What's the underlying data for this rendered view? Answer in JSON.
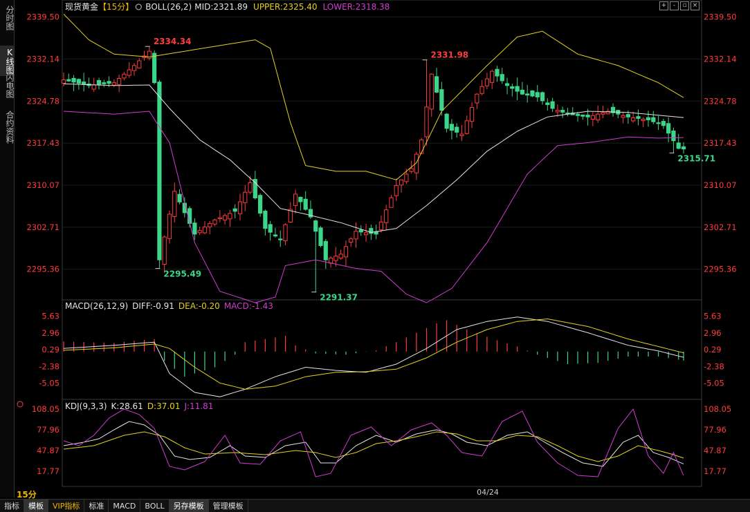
{
  "sidebar": {
    "items": [
      "分时图",
      "K线图",
      "闪电图",
      "合约资料"
    ],
    "active_index": 1
  },
  "header": {
    "symbol": "现货黄金",
    "period_tag": "【15分】",
    "indicator": "BOLL(26,2)",
    "mid_label": "MID:",
    "mid": "2321.89",
    "upper_label": "UPPER:",
    "upper": "2325.40",
    "lower_label": "LOWER:",
    "lower": "2318.38",
    "window_icons": [
      "expand-icon",
      "shrink-icon",
      "restore-icon",
      "close-icon"
    ]
  },
  "macd_header": {
    "name": "MACD(26,12,9)",
    "diff_label": "DIFF:",
    "diff": "-0.91",
    "dea_label": "DEA:",
    "dea": "-0.20",
    "macd_label": "MACD:",
    "macd": "-1.43"
  },
  "kdj_header": {
    "name": "KDJ(9,3,3)",
    "k_label": "K:",
    "k": "28.61",
    "d_label": "D:",
    "d": "37.01",
    "j_label": "J:",
    "j": "11.81"
  },
  "bottom": {
    "period": "15分",
    "date_label": "04/24",
    "tabs": [
      "指标",
      "模板",
      "VIP指标",
      "标准",
      "MACD",
      "BOLL",
      "另存模板",
      "管理模板"
    ],
    "active_tabs": [
      1,
      6
    ],
    "vip_tab": 2
  },
  "colors": {
    "up": "#ff3c3c",
    "down": "#3cd68a",
    "mid": "#e6e6e6",
    "upper": "#e6d21e",
    "lower": "#d23cd2",
    "axis_text": "#ff3c3c",
    "macd_dea": "#e6d21e",
    "kdj_j": "#d23cd2"
  },
  "chart_data": [
    {
      "type": "candlestick",
      "name_label": "现货黄金 15分",
      "y_ticks": [
        "2339.50",
        "2332.14",
        "2324.78",
        "2317.43",
        "2310.07",
        "2302.71",
        "2295.36"
      ],
      "ylim": [
        2290.0,
        2341.5
      ],
      "annotations": [
        {
          "text": "2334.34",
          "index": 17,
          "value": 2334.34,
          "kind": "high"
        },
        {
          "text": "2295.49",
          "index": 19,
          "value": 2295.49,
          "kind": "low"
        },
        {
          "text": "2291.37",
          "index": 50,
          "value": 2291.37,
          "kind": "low"
        },
        {
          "text": "2331.98",
          "index": 72,
          "value": 2331.98,
          "kind": "high"
        },
        {
          "text": "2315.71",
          "index": 121,
          "value": 2315.71,
          "kind": "low"
        }
      ],
      "ohlc_keypoints": [
        [
          0,
          2328.5
        ],
        [
          5,
          2327.5
        ],
        [
          10,
          2328.0
        ],
        [
          14,
          2331.0
        ],
        [
          17,
          2333.5
        ],
        [
          18,
          2328.0
        ],
        [
          19,
          2297.0
        ],
        [
          22,
          2309.0
        ],
        [
          26,
          2301.5
        ],
        [
          30,
          2304.0
        ],
        [
          34,
          2305.5
        ],
        [
          37,
          2310.5
        ],
        [
          40,
          2302.5
        ],
        [
          43,
          2300.5
        ],
        [
          46,
          2308.5
        ],
        [
          49,
          2304.5
        ],
        [
          52,
          2297.0
        ],
        [
          55,
          2298.0
        ],
        [
          58,
          2302.0
        ],
        [
          62,
          2301.5
        ],
        [
          66,
          2310.0
        ],
        [
          69,
          2313.0
        ],
        [
          71,
          2318.0
        ],
        [
          73,
          2329.5
        ],
        [
          76,
          2320.0
        ],
        [
          79,
          2319.0
        ],
        [
          82,
          2326.0
        ],
        [
          85,
          2330.0
        ],
        [
          88,
          2327.5
        ],
        [
          91,
          2326.0
        ],
        [
          94,
          2325.5
        ],
        [
          97,
          2323.5
        ],
        [
          100,
          2322.5
        ],
        [
          104,
          2322.0
        ],
        [
          108,
          2323.0
        ],
        [
          112,
          2322.0
        ],
        [
          116,
          2321.5
        ],
        [
          119,
          2320.5
        ],
        [
          122,
          2316.5
        ]
      ],
      "series_mid_keypoints": [
        [
          0,
          2327.8
        ],
        [
          10,
          2327.5
        ],
        [
          17,
          2327.6
        ],
        [
          21,
          2323.5
        ],
        [
          27,
          2318.0
        ],
        [
          33,
          2314.5
        ],
        [
          38,
          2310.5
        ],
        [
          43,
          2306.0
        ],
        [
          48,
          2305.0
        ],
        [
          55,
          2303.5
        ],
        [
          61,
          2301.8
        ],
        [
          66,
          2302.5
        ],
        [
          72,
          2306.5
        ],
        [
          78,
          2311.0
        ],
        [
          84,
          2316.0
        ],
        [
          90,
          2319.5
        ],
        [
          96,
          2322.0
        ],
        [
          104,
          2323.0
        ],
        [
          112,
          2322.8
        ],
        [
          118,
          2322.3
        ],
        [
          123,
          2321.9
        ]
      ],
      "series_upper_keypoints": [
        [
          0,
          2340.0
        ],
        [
          5,
          2335.5
        ],
        [
          10,
          2333.0
        ],
        [
          17,
          2332.5
        ],
        [
          38,
          2335.5
        ],
        [
          41,
          2334.0
        ],
        [
          45,
          2321.0
        ],
        [
          48,
          2313.5
        ],
        [
          54,
          2312.5
        ],
        [
          60,
          2312.5
        ],
        [
          66,
          2311.0
        ],
        [
          70,
          2314.0
        ],
        [
          75,
          2323.0
        ],
        [
          84,
          2331.0
        ],
        [
          90,
          2336.0
        ],
        [
          95,
          2337.0
        ],
        [
          102,
          2333.0
        ],
        [
          110,
          2331.0
        ],
        [
          118,
          2328.0
        ],
        [
          123,
          2325.4
        ]
      ],
      "series_lower_keypoints": [
        [
          0,
          2323.0
        ],
        [
          10,
          2322.5
        ],
        [
          17,
          2323.0
        ],
        [
          21,
          2317.5
        ],
        [
          26,
          2300.0
        ],
        [
          31,
          2291.5
        ],
        [
          38,
          2289.5
        ],
        [
          42,
          2290.5
        ],
        [
          44,
          2296.0
        ],
        [
          50,
          2297.0
        ],
        [
          58,
          2295.5
        ],
        [
          63,
          2295.0
        ],
        [
          68,
          2291.0
        ],
        [
          72,
          2289.5
        ],
        [
          77,
          2292.0
        ],
        [
          84,
          2300.0
        ],
        [
          92,
          2312.0
        ],
        [
          98,
          2317.0
        ],
        [
          104,
          2317.5
        ],
        [
          112,
          2318.5
        ],
        [
          118,
          2318.3
        ],
        [
          123,
          2318.4
        ]
      ]
    },
    {
      "type": "line",
      "name_label": "MACD(26,12,9)",
      "y_ticks": [
        "5.63",
        "2.96",
        "0.29",
        "-2.38",
        "-5.05"
      ],
      "ylim": [
        -7.5,
        6.8
      ],
      "diff_keypoints": [
        [
          0,
          0.5
        ],
        [
          10,
          1.0
        ],
        [
          18,
          1.5
        ],
        [
          21,
          -3.5
        ],
        [
          26,
          -6.5
        ],
        [
          31,
          -7.2
        ],
        [
          36,
          -6.0
        ],
        [
          42,
          -4.0
        ],
        [
          48,
          -2.5
        ],
        [
          54,
          -3.0
        ],
        [
          60,
          -3.3
        ],
        [
          66,
          -2.0
        ],
        [
          72,
          0.5
        ],
        [
          78,
          3.5
        ],
        [
          84,
          4.8
        ],
        [
          90,
          5.5
        ],
        [
          96,
          4.8
        ],
        [
          104,
          3.0
        ],
        [
          112,
          1.0
        ],
        [
          118,
          0.1
        ],
        [
          123,
          -0.91
        ]
      ],
      "dea_keypoints": [
        [
          0,
          0.2
        ],
        [
          10,
          0.6
        ],
        [
          18,
          1.2
        ],
        [
          21,
          0.5
        ],
        [
          26,
          -2.5
        ],
        [
          31,
          -5.0
        ],
        [
          36,
          -6.0
        ],
        [
          42,
          -5.5
        ],
        [
          48,
          -4.0
        ],
        [
          54,
          -3.3
        ],
        [
          60,
          -3.2
        ],
        [
          66,
          -2.8
        ],
        [
          72,
          -1.0
        ],
        [
          78,
          1.5
        ],
        [
          84,
          3.5
        ],
        [
          90,
          4.8
        ],
        [
          96,
          5.2
        ],
        [
          104,
          4.0
        ],
        [
          112,
          2.0
        ],
        [
          118,
          0.8
        ],
        [
          123,
          -0.2
        ]
      ],
      "hist_keypoints": [
        [
          0,
          1.6
        ],
        [
          10,
          1.4
        ],
        [
          18,
          2.0
        ],
        [
          20,
          -1.5
        ],
        [
          24,
          -4.0
        ],
        [
          30,
          -2.5
        ],
        [
          34,
          -0.5
        ],
        [
          36,
          1.5
        ],
        [
          40,
          2.0
        ],
        [
          44,
          2.5
        ],
        [
          46,
          1.0
        ],
        [
          50,
          -0.3
        ],
        [
          56,
          -0.5
        ],
        [
          62,
          0.2
        ],
        [
          66,
          1.5
        ],
        [
          70,
          3.0
        ],
        [
          74,
          4.5
        ],
        [
          76,
          5.0
        ],
        [
          80,
          3.5
        ],
        [
          86,
          1.8
        ],
        [
          90,
          0.8
        ],
        [
          94,
          -0.5
        ],
        [
          100,
          -2.0
        ],
        [
          106,
          -1.8
        ],
        [
          112,
          -0.8
        ],
        [
          118,
          -0.8
        ],
        [
          123,
          -1.43
        ]
      ]
    },
    {
      "type": "line",
      "name_label": "KDJ(9,3,3)",
      "y_ticks": [
        "108.05",
        "77.96",
        "47.87",
        "17.77"
      ],
      "ylim": [
        0,
        115
      ],
      "k_keypoints": [
        [
          0,
          55
        ],
        [
          4,
          60
        ],
        [
          7,
          65
        ],
        [
          10,
          78
        ],
        [
          13,
          90
        ],
        [
          16,
          85
        ],
        [
          19,
          70
        ],
        [
          22,
          40
        ],
        [
          25,
          35
        ],
        [
          29,
          38
        ],
        [
          33,
          55
        ],
        [
          36,
          40
        ],
        [
          40,
          38
        ],
        [
          44,
          55
        ],
        [
          48,
          60
        ],
        [
          51,
          30
        ],
        [
          54,
          30
        ],
        [
          58,
          55
        ],
        [
          62,
          70
        ],
        [
          66,
          60
        ],
        [
          70,
          72
        ],
        [
          74,
          78
        ],
        [
          77,
          72
        ],
        [
          80,
          60
        ],
        [
          84,
          55
        ],
        [
          88,
          70
        ],
        [
          92,
          75
        ],
        [
          95,
          62
        ],
        [
          99,
          45
        ],
        [
          103,
          30
        ],
        [
          107,
          25
        ],
        [
          111,
          60
        ],
        [
          114,
          70
        ],
        [
          117,
          45
        ],
        [
          120,
          38
        ],
        [
          123,
          28.61
        ]
      ],
      "d_keypoints": [
        [
          0,
          50
        ],
        [
          6,
          55
        ],
        [
          12,
          70
        ],
        [
          16,
          75
        ],
        [
          20,
          68
        ],
        [
          24,
          52
        ],
        [
          28,
          43
        ],
        [
          34,
          45
        ],
        [
          40,
          42
        ],
        [
          46,
          48
        ],
        [
          50,
          45
        ],
        [
          54,
          38
        ],
        [
          58,
          45
        ],
        [
          62,
          58
        ],
        [
          66,
          62
        ],
        [
          70,
          68
        ],
        [
          74,
          75
        ],
        [
          78,
          72
        ],
        [
          82,
          62
        ],
        [
          86,
          62
        ],
        [
          90,
          70
        ],
        [
          94,
          68
        ],
        [
          98,
          55
        ],
        [
          102,
          40
        ],
        [
          106,
          32
        ],
        [
          110,
          40
        ],
        [
          114,
          55
        ],
        [
          118,
          48
        ],
        [
          121,
          42
        ],
        [
          123,
          37.01
        ]
      ],
      "j_keypoints": [
        [
          0,
          62
        ],
        [
          3,
          55
        ],
        [
          6,
          70
        ],
        [
          9,
          95
        ],
        [
          12,
          108
        ],
        [
          15,
          100
        ],
        [
          18,
          80
        ],
        [
          21,
          25
        ],
        [
          24,
          20
        ],
        [
          28,
          32
        ],
        [
          32,
          70
        ],
        [
          35,
          30
        ],
        [
          39,
          28
        ],
        [
          43,
          62
        ],
        [
          47,
          75
        ],
        [
          50,
          10
        ],
        [
          53,
          15
        ],
        [
          57,
          70
        ],
        [
          61,
          82
        ],
        [
          65,
          55
        ],
        [
          69,
          78
        ],
        [
          73,
          88
        ],
        [
          76,
          70
        ],
        [
          79,
          45
        ],
        [
          83,
          40
        ],
        [
          87,
          90
        ],
        [
          91,
          105
        ],
        [
          94,
          60
        ],
        [
          98,
          30
        ],
        [
          102,
          12
        ],
        [
          106,
          10
        ],
        [
          110,
          80
        ],
        [
          113,
          108
        ],
        [
          116,
          40
        ],
        [
          119,
          15
        ],
        [
          121,
          45
        ],
        [
          123,
          11.81
        ]
      ]
    }
  ]
}
